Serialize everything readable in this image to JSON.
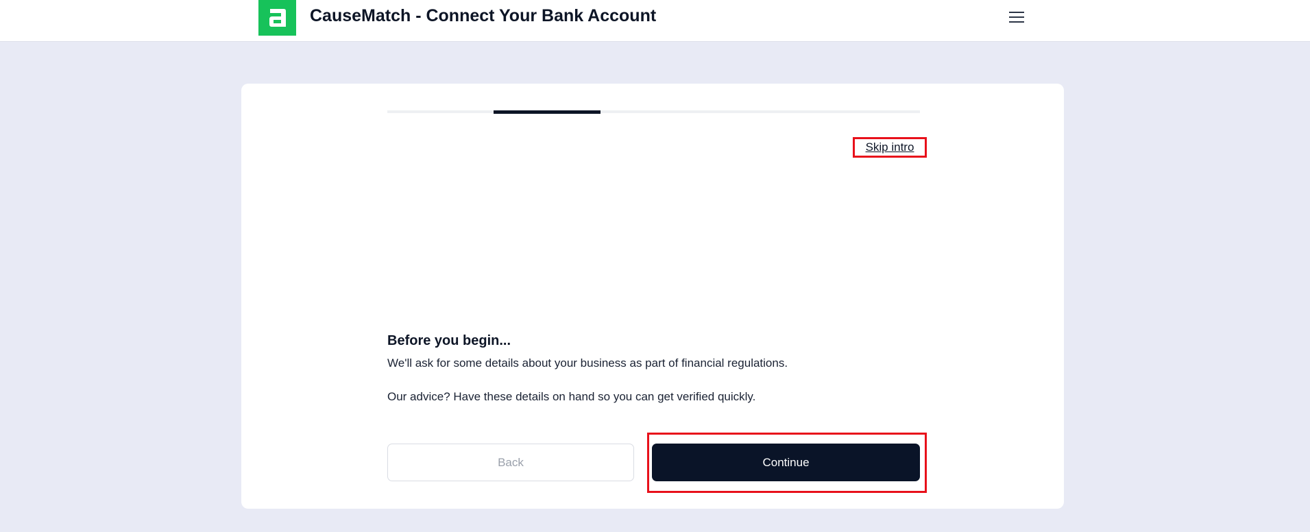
{
  "header": {
    "title": "CauseMatch - Connect Your Bank Account",
    "logo_icon": "brand-logo-a",
    "menu_icon": "hamburger-menu-icon"
  },
  "onboarding": {
    "progress": {
      "steps_total": 5,
      "current_step": 2
    },
    "skip_label": "Skip intro",
    "heading": "Before you begin...",
    "paragraph_1": "We'll ask for some details about your business as part of financial regulations.",
    "paragraph_2": "Our advice? Have these details on hand so you can get verified quickly.",
    "back_label": "Back",
    "continue_label": "Continue"
  },
  "colors": {
    "brand_green": "#17c25a",
    "primary_dark": "#0a1428",
    "page_background": "#e8eaf5",
    "highlight_red": "#e8101a"
  }
}
